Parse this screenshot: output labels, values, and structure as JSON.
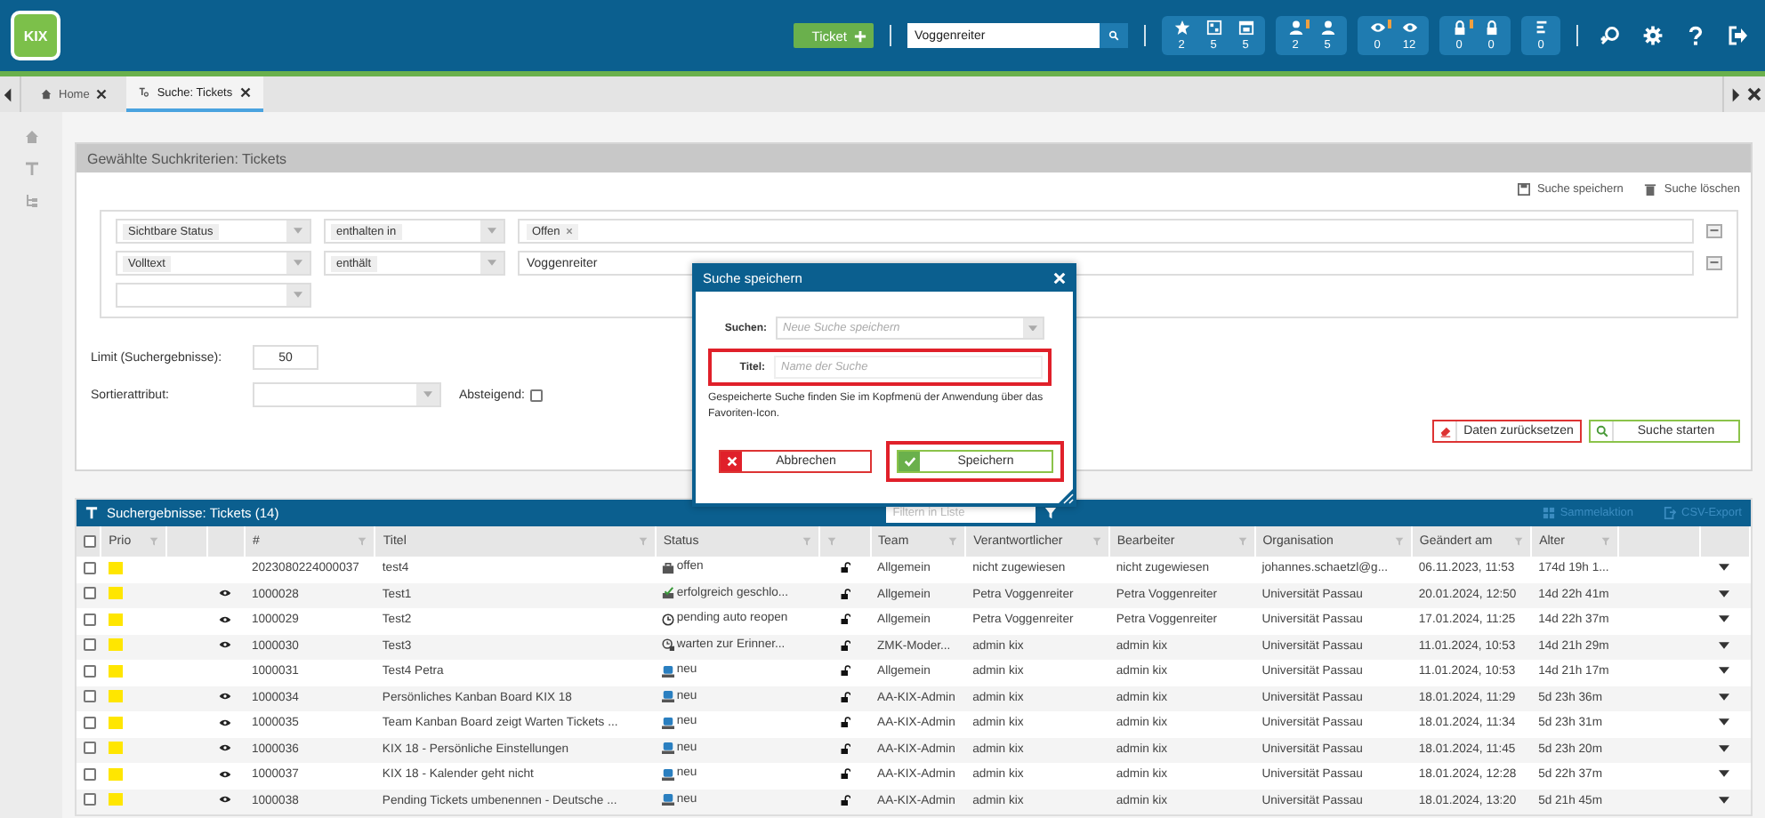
{
  "header": {
    "logo": "KIX",
    "new_ticket_button": "Ticket",
    "search": {
      "value": "Voggenreiter"
    },
    "counter_groups": [
      {
        "items": [
          {
            "kind": "star",
            "alert": false,
            "count": "2"
          },
          {
            "kind": "board",
            "alert": false,
            "count": "5"
          },
          {
            "kind": "calendar",
            "alert": false,
            "count": "5"
          }
        ]
      },
      {
        "items": [
          {
            "kind": "person",
            "alert": true,
            "count": "2"
          },
          {
            "kind": "person",
            "alert": false,
            "count": "5"
          }
        ]
      },
      {
        "items": [
          {
            "kind": "eye",
            "alert": true,
            "count": "0"
          },
          {
            "kind": "eye",
            "alert": false,
            "count": "12"
          }
        ]
      },
      {
        "items": [
          {
            "kind": "lock",
            "alert": true,
            "count": "0"
          },
          {
            "kind": "lock",
            "alert": false,
            "count": "0"
          }
        ]
      },
      {
        "items": [
          {
            "kind": "list",
            "alert": false,
            "count": "0"
          }
        ]
      }
    ]
  },
  "tabs": [
    {
      "kind": "home",
      "label": "Home",
      "selected": false
    },
    {
      "kind": "search",
      "label": "Suche: Tickets",
      "selected": true
    }
  ],
  "criteria_panel": {
    "title": "Gewählte Suchkriterien: Tickets",
    "actions": [
      {
        "kind": "save",
        "label": "Suche speichern"
      },
      {
        "kind": "delete",
        "label": "Suche löschen"
      }
    ],
    "criteria": [
      {
        "kind": "chips",
        "attribute": "Sichtbare Status",
        "operator": "enthalten in",
        "chips": [
          "Offen"
        ]
      },
      {
        "kind": "text",
        "attribute": "Volltext",
        "operator": "enthält",
        "value": "Voggenreiter"
      },
      {
        "kind": "empty"
      }
    ],
    "limit_label": "Limit (Suchergebnisse):",
    "limit_value": "50",
    "sort_label": "Sortierattribut:",
    "descending_label": "Absteigend:",
    "descending_checked": false,
    "reset_button": "Daten zurücksetzen",
    "start_button": "Suche starten"
  },
  "results": {
    "title": "Suchergebnisse: Tickets (14)",
    "filter_placeholder": "Filtern in Liste",
    "actions": [
      {
        "kind": "bulk",
        "label": "Sammelaktion",
        "disabled": true
      },
      {
        "kind": "export",
        "label": "CSV-Export",
        "disabled": true
      }
    ],
    "select_all_checked": false,
    "columns": [
      {
        "label": "Prio",
        "filter": true
      },
      {
        "filter": false
      },
      {
        "filter": false
      },
      {
        "label": "#",
        "filter": true
      },
      {
        "label": "Titel",
        "filter": true
      },
      {
        "label": "Status",
        "filter": true
      },
      {
        "filter": true
      },
      {
        "label": "Team",
        "filter": true
      },
      {
        "label": "Verantwortlicher",
        "filter": true
      },
      {
        "label": "Bearbeiter",
        "filter": true
      },
      {
        "label": "Organisation",
        "filter": true
      },
      {
        "label": "Geändert am",
        "filter": true
      },
      {
        "label": "Alter",
        "filter": true
      },
      {
        "filter": false
      },
      {
        "filter": false
      }
    ],
    "rows": [
      {
        "checked": false,
        "color": "#ffe600",
        "watched": false,
        "number": "2023080224000037",
        "title": "test4",
        "status": {
          "kind": "open",
          "label": "offen"
        },
        "locked": false,
        "team": "Allgemein",
        "responsible": "nicht zugewiesen",
        "owner": "nicht zugewiesen",
        "organisation": "johannes.schaetzl@g...",
        "changed": "06.11.2023, 11:53",
        "age": "174d 19h 1..."
      },
      {
        "checked": false,
        "color": "#ffe600",
        "watched": true,
        "number": "1000028",
        "title": "Test1",
        "status": {
          "kind": "closed",
          "label": "erfolgreich geschlo..."
        },
        "locked": false,
        "team": "Allgemein",
        "responsible": "Petra Voggenreiter",
        "owner": "Petra Voggenreiter",
        "organisation": "Universität Passau",
        "changed": "20.01.2024, 12:50",
        "age": "14d 22h 41m"
      },
      {
        "checked": false,
        "color": "#ffe600",
        "watched": true,
        "number": "1000029",
        "title": "Test2",
        "status": {
          "kind": "pending",
          "label": "pending auto reopen"
        },
        "locked": false,
        "team": "Allgemein",
        "responsible": "Petra Voggenreiter",
        "owner": "Petra Voggenreiter",
        "organisation": "Universität Passau",
        "changed": "17.01.2024, 11:25",
        "age": "14d 22h 37m"
      },
      {
        "checked": false,
        "color": "#ffe600",
        "watched": true,
        "number": "1000030",
        "title": "Test3",
        "status": {
          "kind": "reminder",
          "label": "warten zur Erinner..."
        },
        "locked": false,
        "team": "ZMK-Moder...",
        "responsible": "admin kix",
        "owner": "admin kix",
        "organisation": "Universität Passau",
        "changed": "11.01.2024, 10:53",
        "age": "14d 21h 29m"
      },
      {
        "checked": false,
        "color": "#ffe600",
        "watched": false,
        "number": "1000031",
        "title": "Test4 Petra",
        "status": {
          "kind": "new",
          "label": "neu"
        },
        "locked": false,
        "team": "Allgemein",
        "responsible": "admin kix",
        "owner": "admin kix",
        "organisation": "Universität Passau",
        "changed": "11.01.2024, 10:53",
        "age": "14d 21h 17m"
      },
      {
        "checked": false,
        "color": "#ffe600",
        "watched": true,
        "number": "1000034",
        "title": "Persönliches Kanban Board KIX 18",
        "status": {
          "kind": "new",
          "label": "neu"
        },
        "locked": false,
        "team": "AA-KIX-Admin",
        "responsible": "admin kix",
        "owner": "admin kix",
        "organisation": "Universität Passau",
        "changed": "18.01.2024, 11:29",
        "age": "5d 23h 36m"
      },
      {
        "checked": false,
        "color": "#ffe600",
        "watched": true,
        "number": "1000035",
        "title": "Team Kanban Board zeigt Warten Tickets ...",
        "status": {
          "kind": "new",
          "label": "neu"
        },
        "locked": false,
        "team": "AA-KIX-Admin",
        "responsible": "admin kix",
        "owner": "admin kix",
        "organisation": "Universität Passau",
        "changed": "18.01.2024, 11:34",
        "age": "5d 23h 31m"
      },
      {
        "checked": false,
        "color": "#ffe600",
        "watched": true,
        "number": "1000036",
        "title": "KIX 18 - Persönliche Einstellungen",
        "status": {
          "kind": "new",
          "label": "neu"
        },
        "locked": false,
        "team": "AA-KIX-Admin",
        "responsible": "admin kix",
        "owner": "admin kix",
        "organisation": "Universität Passau",
        "changed": "18.01.2024, 11:45",
        "age": "5d 23h 20m"
      },
      {
        "checked": false,
        "color": "#ffe600",
        "watched": true,
        "number": "1000037",
        "title": "KIX 18 - Kalender geht nicht",
        "status": {
          "kind": "new",
          "label": "neu"
        },
        "locked": false,
        "team": "AA-KIX-Admin",
        "responsible": "admin kix",
        "owner": "admin kix",
        "organisation": "Universität Passau",
        "changed": "18.01.2024, 12:28",
        "age": "5d 22h 37m"
      },
      {
        "checked": false,
        "color": "#ffe600",
        "watched": true,
        "number": "1000038",
        "title": "Pending Tickets umbenennen - Deutsche ...",
        "status": {
          "kind": "new",
          "label": "neu"
        },
        "locked": false,
        "team": "AA-KIX-Admin",
        "responsible": "admin kix",
        "owner": "admin kix",
        "organisation": "Universität Passau",
        "changed": "18.01.2024, 13:20",
        "age": "5d 21h 45m"
      }
    ]
  },
  "modal": {
    "title": "Suche speichern",
    "search_label": "Suchen:",
    "search_placeholder": "Neue Suche speichern",
    "title_label": "Titel:",
    "title_placeholder": "Name der Suche",
    "title_highlighted": true,
    "hint": "Gespeicherte Suche finden Sie im Kopfmenü der Anwendung über das Favoriten-Icon.",
    "cancel_button": "Abbrechen",
    "cancel_highlighted": false,
    "save_button": "Speichern",
    "save_highlighted": true
  }
}
